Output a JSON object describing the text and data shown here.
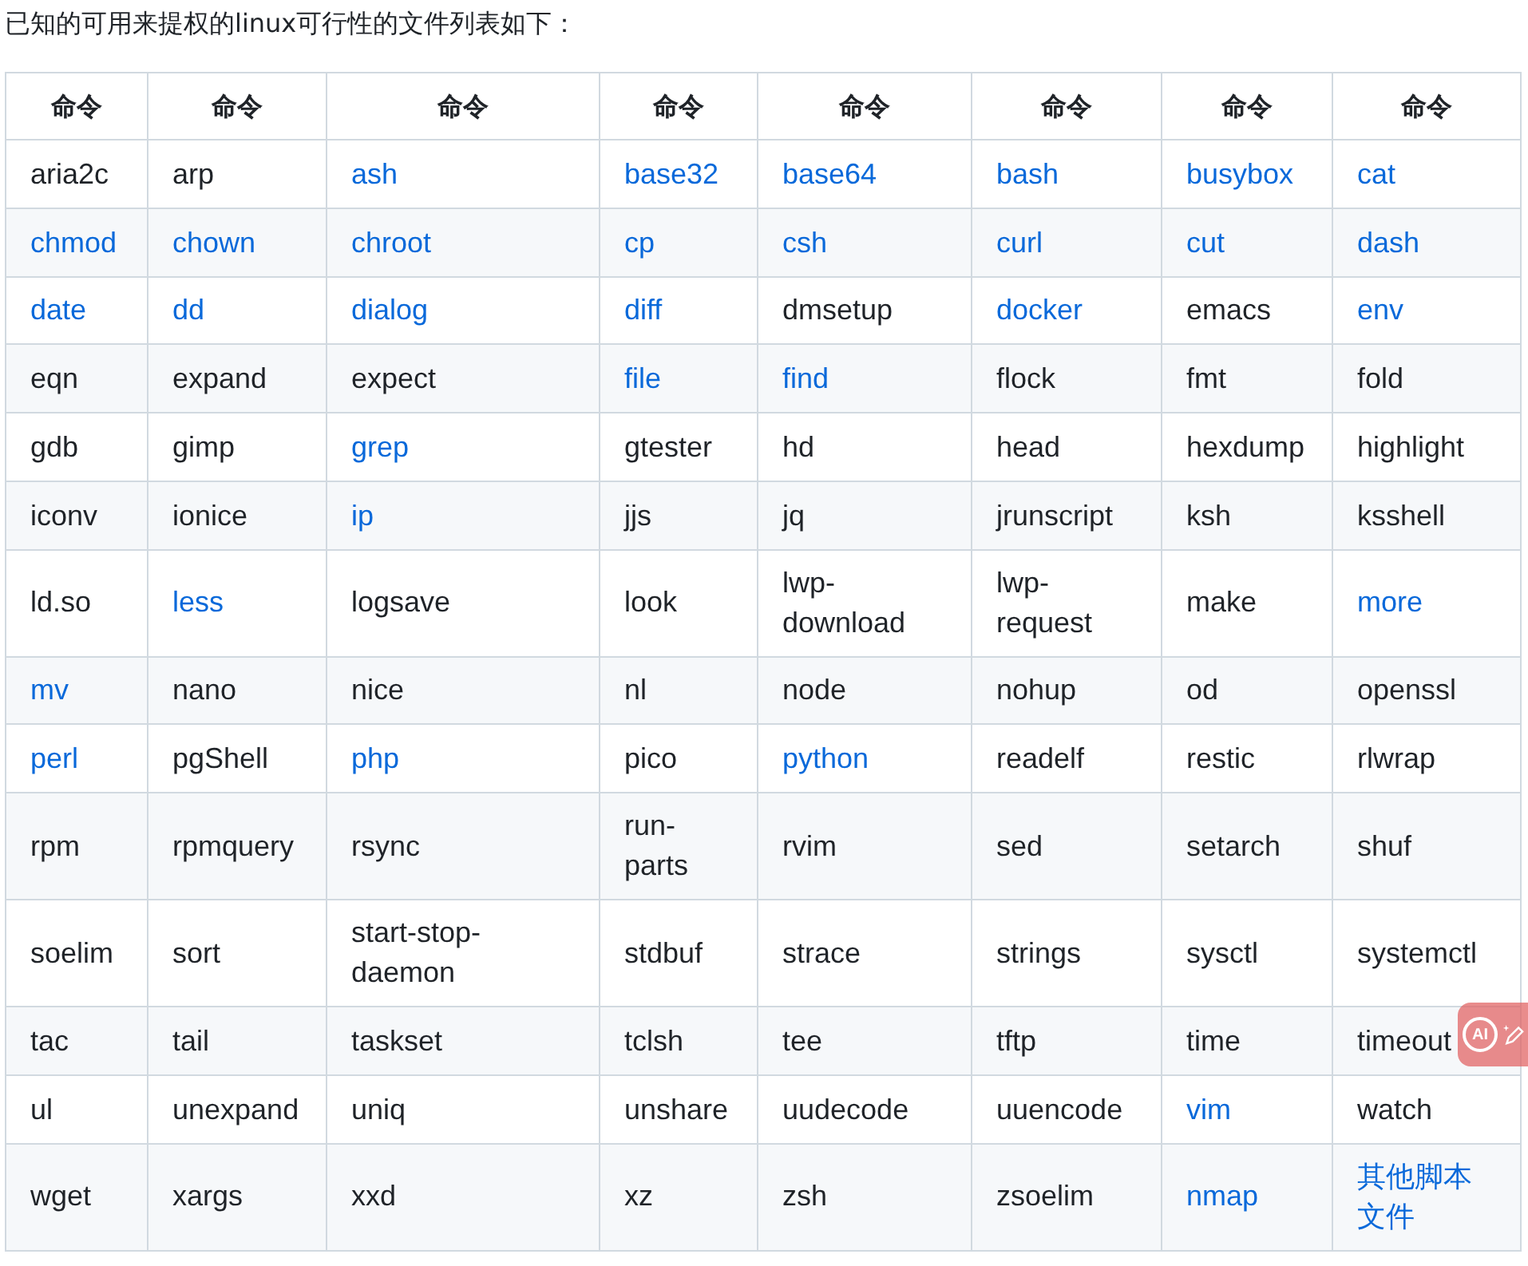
{
  "intro": "已知的可用来提权的linux可行性的文件列表如下：",
  "table": {
    "columns": [
      "命令",
      "命令",
      "命令",
      "命令",
      "命令",
      "命令",
      "命令",
      "命令"
    ],
    "rows": [
      [
        {
          "text": "aria2c",
          "link": false
        },
        {
          "text": "arp",
          "link": false
        },
        {
          "text": "ash",
          "link": true
        },
        {
          "text": "base32",
          "link": true
        },
        {
          "text": "base64",
          "link": true
        },
        {
          "text": "bash",
          "link": true
        },
        {
          "text": "busybox",
          "link": true
        },
        {
          "text": "cat",
          "link": true
        }
      ],
      [
        {
          "text": "chmod",
          "link": true
        },
        {
          "text": "chown",
          "link": true
        },
        {
          "text": "chroot",
          "link": true
        },
        {
          "text": "cp",
          "link": true
        },
        {
          "text": "csh",
          "link": true
        },
        {
          "text": "curl",
          "link": true
        },
        {
          "text": "cut",
          "link": true
        },
        {
          "text": "dash",
          "link": true
        }
      ],
      [
        {
          "text": "date",
          "link": true
        },
        {
          "text": "dd",
          "link": true
        },
        {
          "text": "dialog",
          "link": true
        },
        {
          "text": "diff",
          "link": true
        },
        {
          "text": "dmsetup",
          "link": false
        },
        {
          "text": "docker",
          "link": true
        },
        {
          "text": "emacs",
          "link": false
        },
        {
          "text": "env",
          "link": true
        }
      ],
      [
        {
          "text": "eqn",
          "link": false
        },
        {
          "text": "expand",
          "link": false
        },
        {
          "text": "expect",
          "link": false
        },
        {
          "text": "file",
          "link": true
        },
        {
          "text": "find",
          "link": true
        },
        {
          "text": "flock",
          "link": false
        },
        {
          "text": "fmt",
          "link": false
        },
        {
          "text": "fold",
          "link": false
        }
      ],
      [
        {
          "text": "gdb",
          "link": false
        },
        {
          "text": "gimp",
          "link": false
        },
        {
          "text": "grep",
          "link": true
        },
        {
          "text": "gtester",
          "link": false
        },
        {
          "text": "hd",
          "link": false
        },
        {
          "text": "head",
          "link": false
        },
        {
          "text": "hexdump",
          "link": false
        },
        {
          "text": "highlight",
          "link": false
        }
      ],
      [
        {
          "text": "iconv",
          "link": false
        },
        {
          "text": "ionice",
          "link": false
        },
        {
          "text": "ip",
          "link": true
        },
        {
          "text": "jjs",
          "link": false
        },
        {
          "text": "jq",
          "link": false
        },
        {
          "text": "jrunscript",
          "link": false
        },
        {
          "text": "ksh",
          "link": false
        },
        {
          "text": "ksshell",
          "link": false
        }
      ],
      [
        {
          "text": "ld.so",
          "link": false
        },
        {
          "text": "less",
          "link": true
        },
        {
          "text": "logsave",
          "link": false
        },
        {
          "text": "look",
          "link": false
        },
        {
          "text": "lwp-download",
          "link": false
        },
        {
          "text": "lwp-request",
          "link": false
        },
        {
          "text": "make",
          "link": false
        },
        {
          "text": "more",
          "link": true
        }
      ],
      [
        {
          "text": "mv",
          "link": true
        },
        {
          "text": "nano",
          "link": false
        },
        {
          "text": "nice",
          "link": false
        },
        {
          "text": "nl",
          "link": false
        },
        {
          "text": "node",
          "link": false
        },
        {
          "text": "nohup",
          "link": false
        },
        {
          "text": "od",
          "link": false
        },
        {
          "text": "openssl",
          "link": false
        }
      ],
      [
        {
          "text": "perl",
          "link": true
        },
        {
          "text": "pgShell",
          "link": false
        },
        {
          "text": "php",
          "link": true
        },
        {
          "text": "pico",
          "link": false
        },
        {
          "text": "python",
          "link": true
        },
        {
          "text": "readelf",
          "link": false
        },
        {
          "text": "restic",
          "link": false
        },
        {
          "text": "rlwrap",
          "link": false
        }
      ],
      [
        {
          "text": "rpm",
          "link": false
        },
        {
          "text": "rpmquery",
          "link": false
        },
        {
          "text": "rsync",
          "link": false
        },
        {
          "text": "run-parts",
          "link": false
        },
        {
          "text": "rvim",
          "link": false
        },
        {
          "text": "sed",
          "link": false
        },
        {
          "text": "setarch",
          "link": false
        },
        {
          "text": "shuf",
          "link": false
        }
      ],
      [
        {
          "text": "soelim",
          "link": false
        },
        {
          "text": "sort",
          "link": false
        },
        {
          "text": "start-stop-daemon",
          "link": false
        },
        {
          "text": "stdbuf",
          "link": false
        },
        {
          "text": "strace",
          "link": false
        },
        {
          "text": "strings",
          "link": false
        },
        {
          "text": "sysctl",
          "link": false
        },
        {
          "text": "systemctl",
          "link": false
        }
      ],
      [
        {
          "text": "tac",
          "link": false
        },
        {
          "text": "tail",
          "link": false
        },
        {
          "text": "taskset",
          "link": false
        },
        {
          "text": "tclsh",
          "link": false
        },
        {
          "text": "tee",
          "link": false
        },
        {
          "text": "tftp",
          "link": false
        },
        {
          "text": "time",
          "link": false
        },
        {
          "text": "timeout",
          "link": false
        }
      ],
      [
        {
          "text": "ul",
          "link": false
        },
        {
          "text": "unexpand",
          "link": false
        },
        {
          "text": "uniq",
          "link": false
        },
        {
          "text": "unshare",
          "link": false
        },
        {
          "text": "uudecode",
          "link": false
        },
        {
          "text": "uuencode",
          "link": false
        },
        {
          "text": "vim",
          "link": true
        },
        {
          "text": "watch",
          "link": false
        }
      ],
      [
        {
          "text": "wget",
          "link": false
        },
        {
          "text": "xargs",
          "link": false
        },
        {
          "text": "xxd",
          "link": false
        },
        {
          "text": "xz",
          "link": false
        },
        {
          "text": "zsh",
          "link": false
        },
        {
          "text": "zsoelim",
          "link": false
        },
        {
          "text": "nmap",
          "link": true
        },
        {
          "text": "其他脚本文件",
          "link": true
        }
      ]
    ]
  },
  "ai_widget": {
    "label": "AI"
  }
}
